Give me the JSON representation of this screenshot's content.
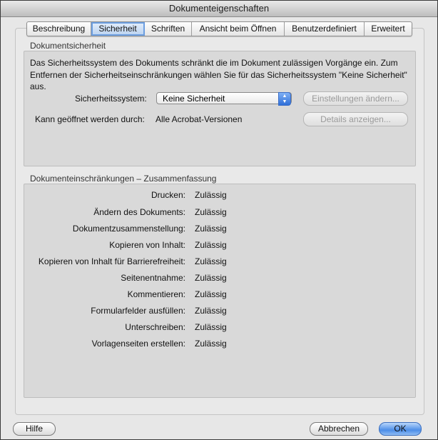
{
  "window": {
    "title": "Dokumenteigenschaften"
  },
  "tabs": [
    {
      "label": "Beschreibung",
      "active": false
    },
    {
      "label": "Sicherheit",
      "active": true
    },
    {
      "label": "Schriften",
      "active": false
    },
    {
      "label": "Ansicht beim Öffnen",
      "active": false
    },
    {
      "label": "Benutzerdefiniert",
      "active": false
    },
    {
      "label": "Erweitert",
      "active": false
    }
  ],
  "security": {
    "section_title": "Dokumentsicherheit",
    "description": "Das Sicherheitssystem des Dokuments schränkt die im Dokument zulässigen Vorgänge ein. Zum Entfernen der Sicherheitseinschränkungen wählen Sie für das Sicherheitssystem \"Keine Sicherheit\" aus.",
    "system_label": "Sicherheitssystem:",
    "system_value": "Keine Sicherheit",
    "change_settings_label": "Einstellungen ändern...",
    "opened_by_label": "Kann geöffnet werden durch:",
    "opened_by_value": "Alle Acrobat-Versionen",
    "details_label": "Details anzeigen..."
  },
  "restrictions": {
    "section_title": "Dokumenteinschränkungen – Zusammenfassung",
    "rows": [
      {
        "label": "Drucken:",
        "value": "Zulässig"
      },
      {
        "label": "Ändern des Dokuments:",
        "value": "Zulässig"
      },
      {
        "label": "Dokumentzusammenstellung:",
        "value": "Zulässig"
      },
      {
        "label": "Kopieren von Inhalt:",
        "value": "Zulässig"
      },
      {
        "label": "Kopieren von Inhalt für Barrierefreiheit:",
        "value": "Zulässig"
      },
      {
        "label": "Seitenentnahme:",
        "value": "Zulässig"
      },
      {
        "label": "Kommentieren:",
        "value": "Zulässig"
      },
      {
        "label": "Formularfelder ausfüllen:",
        "value": "Zulässig"
      },
      {
        "label": "Unterschreiben:",
        "value": "Zulässig"
      },
      {
        "label": "Vorlagenseiten erstellen:",
        "value": "Zulässig"
      }
    ]
  },
  "footer": {
    "help_label": "Hilfe",
    "cancel_label": "Abbrechen",
    "ok_label": "OK"
  },
  "icons": {
    "popup_arrows": "popup-stepper-icon"
  },
  "colors": {
    "accent": "#4c8ee8",
    "panel": "#d9d9d9",
    "window": "#e7e7e7"
  }
}
